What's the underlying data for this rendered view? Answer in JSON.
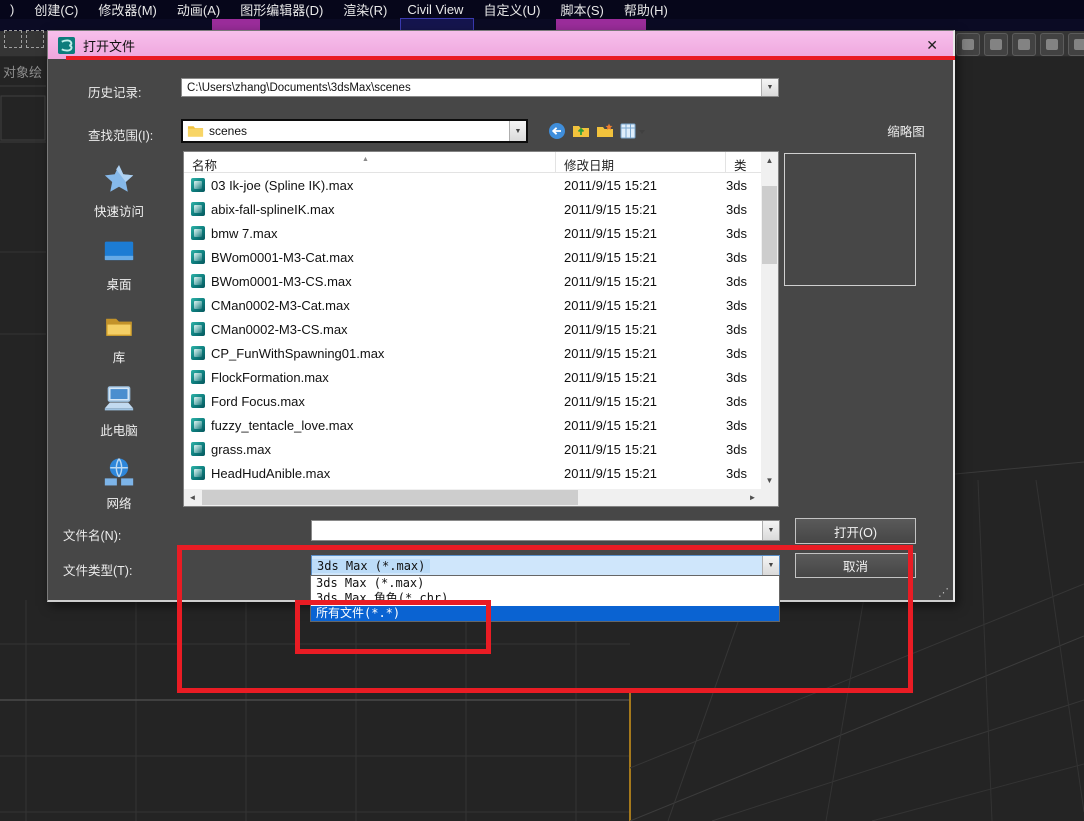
{
  "accent_colors": {
    "annotation_red": "#e91c24",
    "selection_blue": "#0a63d2",
    "title_bar_pink": "#f2aee2"
  },
  "menu_bar": {
    "items": [
      ")",
      "创建(C)",
      "修改器(M)",
      "动画(A)",
      "图形编辑器(D)",
      "渲染(R)",
      "Civil View",
      "自定义(U)",
      "脚本(S)",
      "帮助(H)"
    ]
  },
  "side_label": "对象绘",
  "dialog": {
    "title": "打开文件",
    "close_glyph": "✕",
    "fields": {
      "history_label": "历史记录:",
      "history_value": "C:\\Users\\zhang\\Documents\\3dsMax\\scenes",
      "look_in_label": "查找范围(I):",
      "look_in_value": "scenes",
      "file_name_label": "文件名(N):",
      "file_name_value": "",
      "file_type_label": "文件类型(T):",
      "file_type_value": "3ds Max (*.max)"
    },
    "thumbnail_label": "缩略图",
    "buttons": {
      "open": "打开(O)",
      "cancel": "取消"
    },
    "sidebar_items": [
      {
        "label": "快速访问",
        "icon": "star-icon"
      },
      {
        "label": "桌面",
        "icon": "desktop-icon"
      },
      {
        "label": "库",
        "icon": "library-icon"
      },
      {
        "label": "此电脑",
        "icon": "computer-icon"
      },
      {
        "label": "网络",
        "icon": "network-icon"
      }
    ],
    "file_list": {
      "columns": {
        "name": "名称",
        "date": "修改日期",
        "type": "类"
      },
      "rows": [
        {
          "name": "03 Ik-joe (Spline IK).max",
          "date": "2011/9/15 15:21",
          "type": "3ds"
        },
        {
          "name": "abix-fall-splineIK.max",
          "date": "2011/9/15 15:21",
          "type": "3ds"
        },
        {
          "name": "bmw 7.max",
          "date": "2011/9/15 15:21",
          "type": "3ds"
        },
        {
          "name": "BWom0001-M3-Cat.max",
          "date": "2011/9/15 15:21",
          "type": "3ds"
        },
        {
          "name": "BWom0001-M3-CS.max",
          "date": "2011/9/15 15:21",
          "type": "3ds"
        },
        {
          "name": "CMan0002-M3-Cat.max",
          "date": "2011/9/15 15:21",
          "type": "3ds"
        },
        {
          "name": "CMan0002-M3-CS.max",
          "date": "2011/9/15 15:21",
          "type": "3ds"
        },
        {
          "name": "CP_FunWithSpawning01.max",
          "date": "2011/9/15 15:21",
          "type": "3ds"
        },
        {
          "name": "FlockFormation.max",
          "date": "2011/9/15 15:21",
          "type": "3ds"
        },
        {
          "name": "Ford Focus.max",
          "date": "2011/9/15 15:21",
          "type": "3ds"
        },
        {
          "name": "fuzzy_tentacle_love.max",
          "date": "2011/9/15 15:21",
          "type": "3ds"
        },
        {
          "name": "grass.max",
          "date": "2011/9/15 15:21",
          "type": "3ds"
        },
        {
          "name": "HeadHudAnible.max",
          "date": "2011/9/15 15:21",
          "type": "3ds"
        }
      ]
    },
    "type_dropdown_options": [
      {
        "label": "3ds Max (*.max)"
      },
      {
        "label": "3ds Max 角色(*.chr)"
      },
      {
        "label": "所有文件(*.*)"
      }
    ]
  }
}
